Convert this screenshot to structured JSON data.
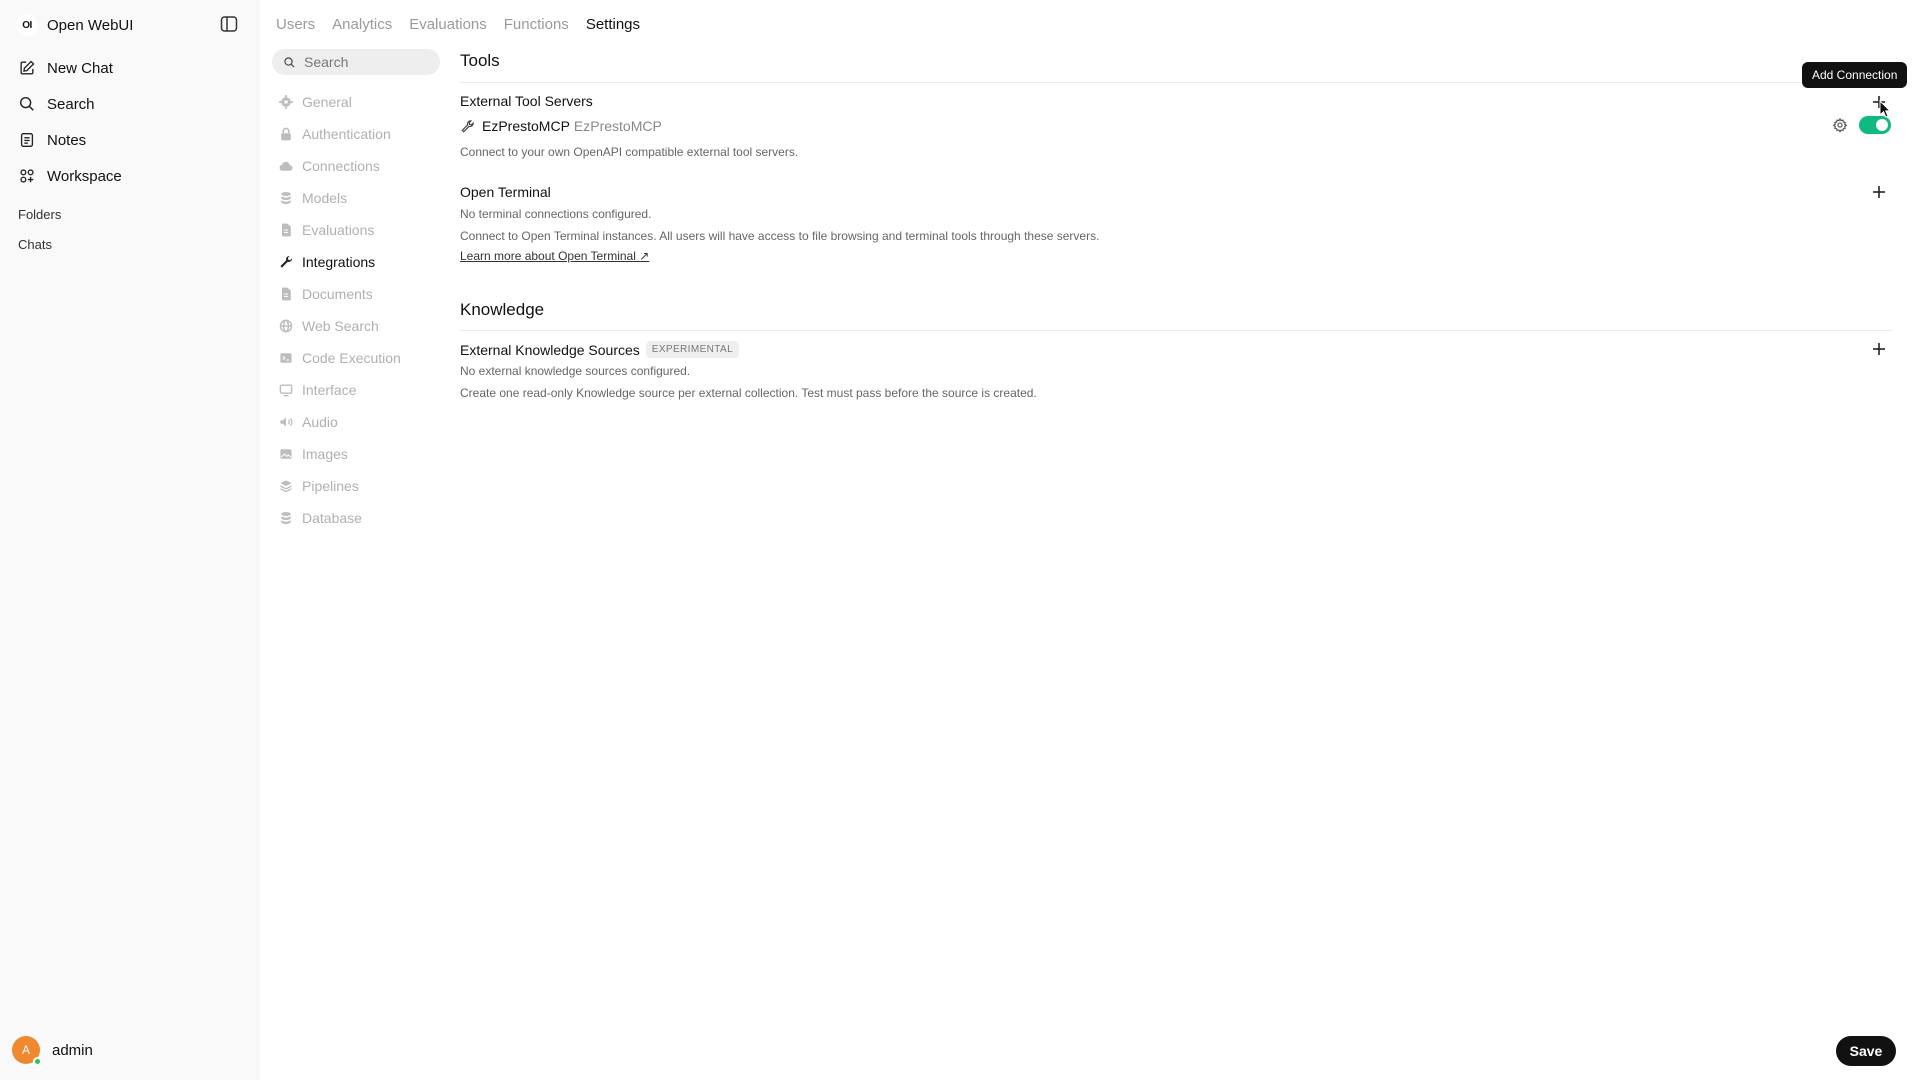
{
  "app": {
    "name": "Open WebUI",
    "logo_text": "OI"
  },
  "sidebar": {
    "nav": [
      {
        "label": "New Chat",
        "icon": "pencil-square-icon"
      },
      {
        "label": "Search",
        "icon": "search-icon"
      },
      {
        "label": "Notes",
        "icon": "notes-icon"
      },
      {
        "label": "Workspace",
        "icon": "workspace-icon"
      }
    ],
    "folders_label": "Folders",
    "chats_label": "Chats",
    "user": {
      "name": "admin",
      "initial": "A",
      "status": "online"
    }
  },
  "tabs": [
    {
      "label": "Users",
      "active": false
    },
    {
      "label": "Analytics",
      "active": false
    },
    {
      "label": "Evaluations",
      "active": false
    },
    {
      "label": "Functions",
      "active": false
    },
    {
      "label": "Settings",
      "active": true
    }
  ],
  "settings_nav": {
    "search_placeholder": "Search",
    "items": [
      {
        "label": "General",
        "icon": "gear-icon"
      },
      {
        "label": "Authentication",
        "icon": "lock-icon"
      },
      {
        "label": "Connections",
        "icon": "cloud-icon"
      },
      {
        "label": "Models",
        "icon": "database-icon"
      },
      {
        "label": "Evaluations",
        "icon": "document-icon"
      },
      {
        "label": "Integrations",
        "icon": "wrench-icon",
        "active": true
      },
      {
        "label": "Documents",
        "icon": "document-icon"
      },
      {
        "label": "Web Search",
        "icon": "globe-icon"
      },
      {
        "label": "Code Execution",
        "icon": "terminal-icon"
      },
      {
        "label": "Interface",
        "icon": "monitor-icon"
      },
      {
        "label": "Audio",
        "icon": "speaker-icon"
      },
      {
        "label": "Images",
        "icon": "image-icon"
      },
      {
        "label": "Pipelines",
        "icon": "layers-icon"
      },
      {
        "label": "Database",
        "icon": "database-icon"
      }
    ]
  },
  "main": {
    "tools": {
      "heading": "Tools",
      "external_tool_servers": {
        "title": "External Tool Servers",
        "server": {
          "name": "EzPrestoMCP",
          "id": "EzPrestoMCP",
          "enabled": true
        },
        "description": "Connect to your own OpenAPI compatible external tool servers.",
        "add_tooltip": "Add Connection"
      },
      "open_terminal": {
        "title": "Open Terminal",
        "status": "No terminal connections configured.",
        "description": "Connect to Open Terminal instances. All users will have access to file browsing and terminal tools through these servers.",
        "link": "Learn more about Open Terminal ↗"
      }
    },
    "knowledge": {
      "heading": "Knowledge",
      "external_sources": {
        "title": "External Knowledge Sources",
        "badge": "EXPERIMENTAL",
        "status": "No external knowledge sources configured.",
        "description": "Create one read-only Knowledge source per external collection. Test must pass before the source is created."
      }
    },
    "save_label": "Save"
  },
  "colors": {
    "toggle_on": "#10b981",
    "avatar": "#f0882f",
    "online": "#22c55e"
  }
}
